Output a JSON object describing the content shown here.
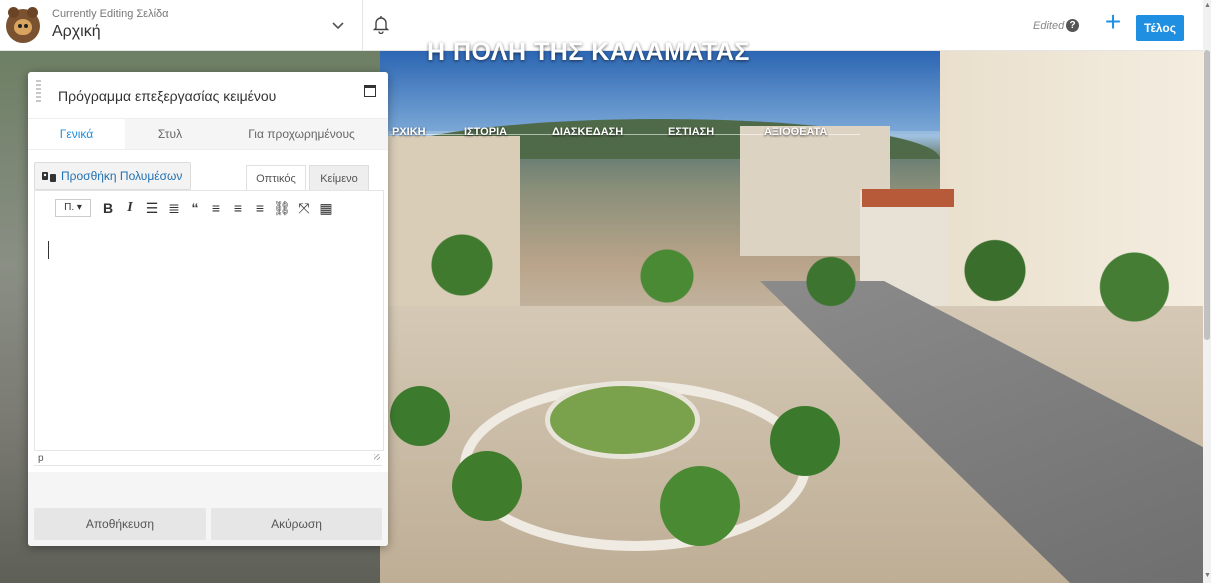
{
  "topbar": {
    "editing_label": "Currently Editing Σελίδα",
    "page_name": "Αρχική",
    "edited_label": "Edited",
    "help_symbol": "?",
    "add_symbol": "+",
    "done_label": "Τέλος"
  },
  "site": {
    "title": "Η ΠΟΛΗ ΤΗΣ ΚΑΛΑΜΑΤΑΣ",
    "nav": [
      "ΡΧΙΚΗ",
      "ΙΣΤΟΡΙΑ",
      "ΔΙΑΣΚΕΔΑΣΗ",
      "ΕΣΤΙΑΣΗ",
      "ΑΞΙΟΘΕΑΤΑ"
    ]
  },
  "editor": {
    "title": "Πρόγραμμα επεξεργασίας κειμένου",
    "tabs": [
      {
        "label": "Γενικά",
        "active": true
      },
      {
        "label": "Στυλ",
        "active": false
      },
      {
        "label": "Για προχωρημένους",
        "active": false
      }
    ],
    "add_media_label": "Προσθήκη Πολυμέσων",
    "view_tabs": [
      {
        "label": "Οπτικός",
        "selected": true
      },
      {
        "label": "Κείμενο",
        "selected": false
      }
    ],
    "format_select": "Π.",
    "status_path": "p",
    "save_label": "Αποθήκευση",
    "cancel_label": "Ακύρωση"
  },
  "colors": {
    "accent": "#1e8fe1",
    "link": "#2271b1"
  },
  "icons": [
    "beaver-logo-icon",
    "chevron-down-icon",
    "bell-icon",
    "help-icon",
    "plus-icon",
    "maximize-icon",
    "add-media-icon",
    "bold-icon",
    "italic-icon",
    "bullet-list-icon",
    "numbered-list-icon",
    "blockquote-icon",
    "align-left-icon",
    "align-center-icon",
    "align-right-icon",
    "link-icon",
    "fullscreen-icon",
    "toolbar-toggle-icon"
  ]
}
